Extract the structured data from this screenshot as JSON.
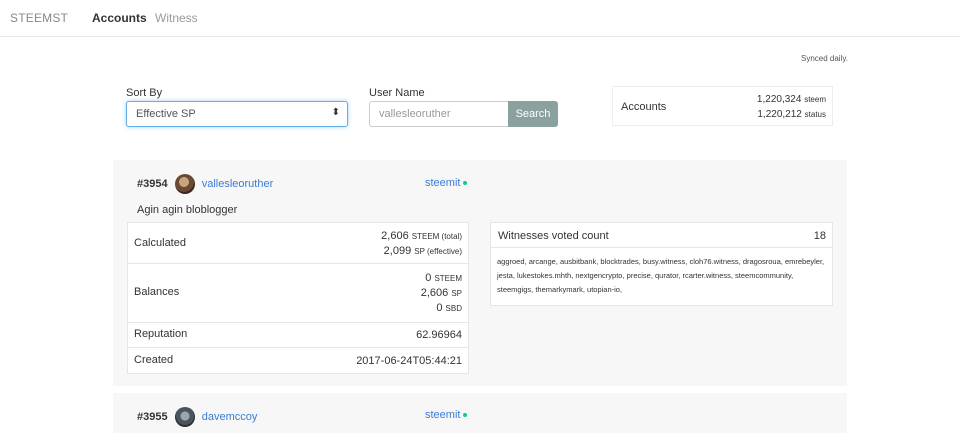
{
  "nav": {
    "brand": "STEEMST",
    "tabs": [
      {
        "label": "Accounts",
        "active": true
      },
      {
        "label": "Witness",
        "active": false
      }
    ]
  },
  "synced_note": "Synced daily.",
  "filters": {
    "sort_label": "Sort By",
    "sort_value": "Effective SP",
    "username_label": "User Name",
    "username_placeholder": "vallesleoruther",
    "search_button": "Search"
  },
  "stats": {
    "label": "Accounts",
    "steem_count": "1,220,324",
    "steem_unit": "steem",
    "status_count": "1,220,212",
    "status_unit": "status"
  },
  "accounts": [
    {
      "rank": "#3954",
      "username": "vallesleoruther",
      "source": "steemit",
      "about": "Agin agin bloblogger",
      "calculated_label": "Calculated",
      "calc_total": "2,606",
      "calc_total_unit": "STEEM (total)",
      "calc_effective": "2,099",
      "calc_effective_unit": "SP (effective)",
      "balances_label": "Balances",
      "bal_steem": "0",
      "bal_steem_unit": "STEEM",
      "bal_sp": "2,606",
      "bal_sp_unit": "SP",
      "bal_sbd": "0",
      "bal_sbd_unit": "SBD",
      "reputation_label": "Reputation",
      "reputation": "62.96964",
      "created_label": "Created",
      "created": "2017-06-24T05:44:21",
      "witness_label": "Witnesses voted count",
      "witness_count": "18",
      "witness_list": "aggroed, arcange, ausbitbank, blocktrades, busy.witness, cloh76.witness, dragosroua, emrebeyler, jesta, lukestokes.mhth, nextgencrypto, precise, qurator, rcarter.witness, steemcommunity, steemgigs, themarkymark, utopian-io,"
    },
    {
      "rank": "#3955",
      "username": "davemccoy",
      "source": "steemit"
    }
  ]
}
